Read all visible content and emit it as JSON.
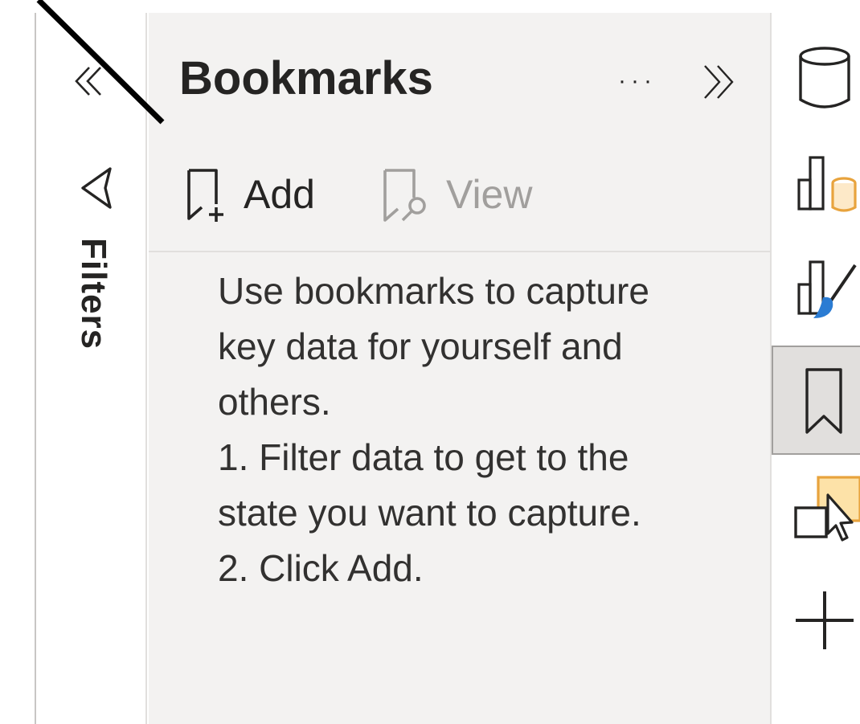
{
  "filters_pane": {
    "label": "Filters",
    "icons": [
      "double-chevron-left-icon",
      "filter-funnel-icon"
    ]
  },
  "bookmarks_pane": {
    "title": "Bookmarks",
    "more_label": "···",
    "collapse_icon": "double-chevron-right-icon",
    "toolbar": {
      "add_label": "Add",
      "view_label": "View",
      "view_disabled": true
    },
    "help_lines": [
      "Use bookmarks to capture",
      "key data for yourself and",
      "others.",
      "1. Filter data to get to the",
      "state you want to capture.",
      "2. Click Add."
    ]
  },
  "rail": {
    "items": [
      "data-cylinder-icon",
      "build-visual-icon",
      "format-paintbrush-icon",
      "bookmark-icon",
      "selection-pane-icon",
      "add-icon"
    ],
    "selected": "bookmark-icon"
  },
  "colors": {
    "pane_background": "#f3f2f1",
    "text": "#252423",
    "disabled_text": "#a19f9d",
    "accent_orange": "#e8a33d",
    "accent_blue": "#2b7cd3"
  }
}
